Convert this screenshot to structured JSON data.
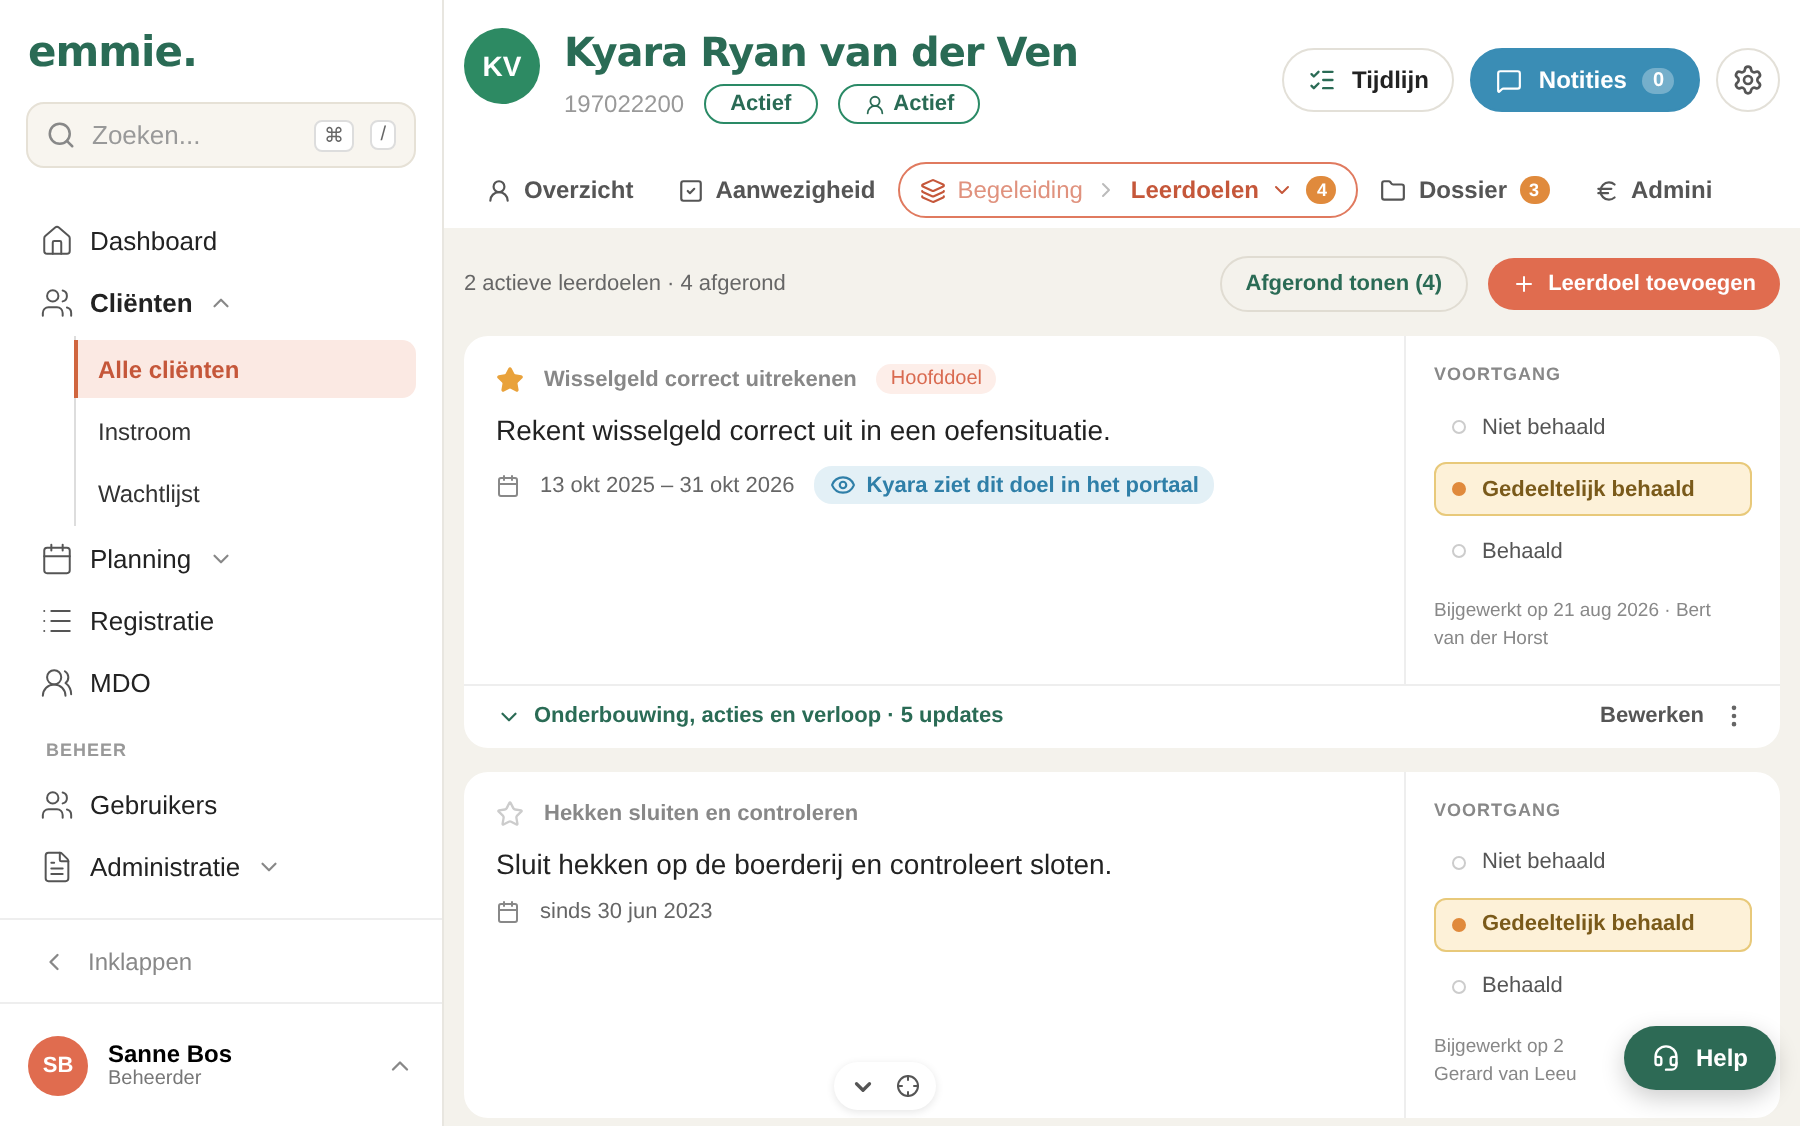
{
  "sidebar": {
    "logo": "emmie.",
    "search": {
      "placeholder": "Zoeken...",
      "keys": [
        "⌘",
        "/"
      ]
    },
    "items": [
      {
        "label": "Dashboard",
        "selected": false
      },
      {
        "label": "Cliënten",
        "selected": false,
        "expanded": true,
        "children": [
          {
            "label": "Alle cliënten",
            "selected": true
          },
          {
            "label": "Instroom",
            "selected": false
          },
          {
            "label": "Wachtlijst",
            "selected": false
          }
        ]
      },
      {
        "label": "Planning",
        "selected": false,
        "expanded": false
      },
      {
        "label": "Registratie",
        "selected": false
      },
      {
        "label": "MDO",
        "selected": false
      }
    ],
    "section": "BEHEER",
    "admin_items": [
      {
        "label": "Gebruikers",
        "selected": false
      },
      {
        "label": "Administratie",
        "selected": false,
        "expanded": false
      }
    ],
    "collapse": "Inklappen",
    "user": {
      "initials": "SB",
      "name": "Sanne Bos",
      "role": "Beheerder"
    }
  },
  "client": {
    "initials": "KV",
    "name": "Kyara Ryan van der Ven",
    "number": "197022200",
    "badges": [
      "Actief",
      "Actief"
    ]
  },
  "actions": {
    "timeline": "Tijdlijn",
    "notes": "Notities",
    "notes_count": "0"
  },
  "tabs": [
    {
      "label": "Overzicht",
      "selected": false
    },
    {
      "label": "Aanwezigheid",
      "selected": false
    },
    {
      "label": "Begeleiding",
      "sublabel": "Leerdoelen",
      "badge": "4",
      "selected": true
    },
    {
      "label": "Dossier",
      "badge": "3",
      "selected": false
    },
    {
      "label": "Admini",
      "selected": false
    }
  ],
  "summary": "2 actieve leerdoelen · 4 afgerond",
  "show_done": "Afgerond tonen (4)",
  "add_goal": "Leerdoel toevoegen",
  "goals": [
    {
      "title": "Wisselgeld correct uitrekenen",
      "starred": true,
      "tag": "Hoofddoel",
      "description": "Rekent wisselgeld correct uit in een oefensituatie.",
      "dates": "13 okt 2025 – 31 okt 2026",
      "portal": "Kyara ziet dit doel in het portaal",
      "progress_title": "VOORTGANG",
      "progress": [
        {
          "label": "Niet behaald",
          "selected": false
        },
        {
          "label": "Gedeeltelijk behaald",
          "selected": true
        },
        {
          "label": "Behaald",
          "selected": false
        }
      ],
      "updated": [
        "Bijgewerkt op 21 aug 2026 · Bert",
        "van der Horst"
      ],
      "footer": "Onderbouwing, acties en verloop · 5 updates",
      "edit": "Bewerken"
    },
    {
      "title": "Hekken sluiten en controleren",
      "starred": false,
      "description": "Sluit hekken op de boerderij en controleert sloten.",
      "dates": "sinds 30 jun 2023",
      "progress_title": "VOORTGANG",
      "progress": [
        {
          "label": "Niet behaald",
          "selected": false
        },
        {
          "label": "Gedeeltelijk behaald",
          "selected": true
        },
        {
          "label": "Behaald",
          "selected": false
        }
      ],
      "updated": [
        "Bijgewerkt op 2",
        "Gerard van Leeu"
      ]
    }
  ],
  "help": "Help"
}
